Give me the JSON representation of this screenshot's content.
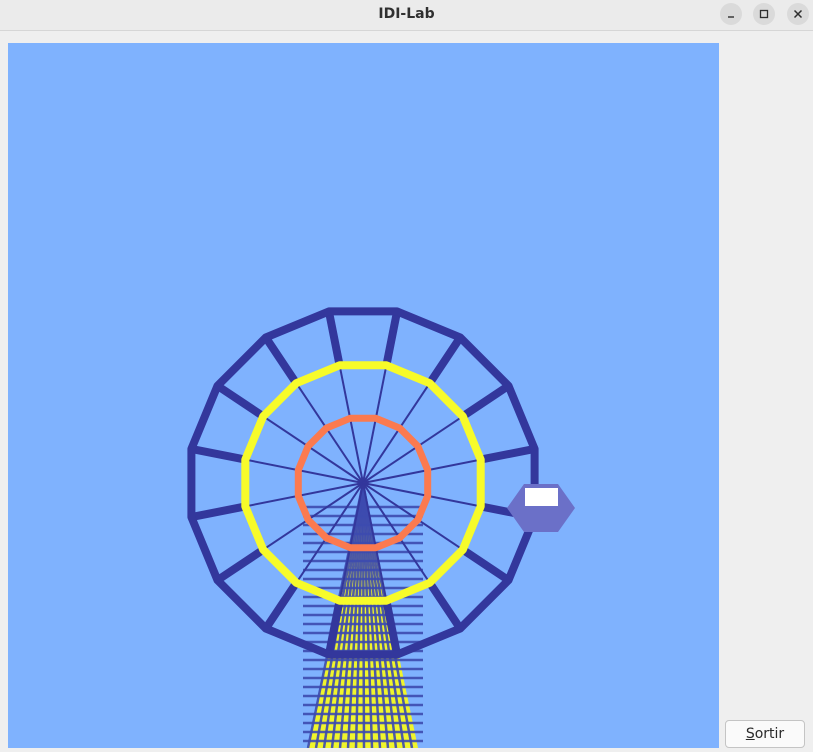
{
  "window": {
    "title": "IDI-Lab",
    "controls": [
      "minimize-icon",
      "maximize-icon",
      "close-icon"
    ]
  },
  "scene": {
    "background": "#7fb2fe",
    "wheel": {
      "spokes": 16,
      "outer_frame_color": "#33379c",
      "spoke_color": "#33379c",
      "middle_ring_color": "#f7fb2a",
      "inner_ring_color": "#fb7a4f",
      "tower_color": "#f0f52b",
      "cabin_color": "#6b70c8",
      "cabin_window_color": "#ffffff"
    }
  },
  "buttons": {
    "sortir_mnemonic": "S",
    "sortir_rest": "ortir"
  }
}
